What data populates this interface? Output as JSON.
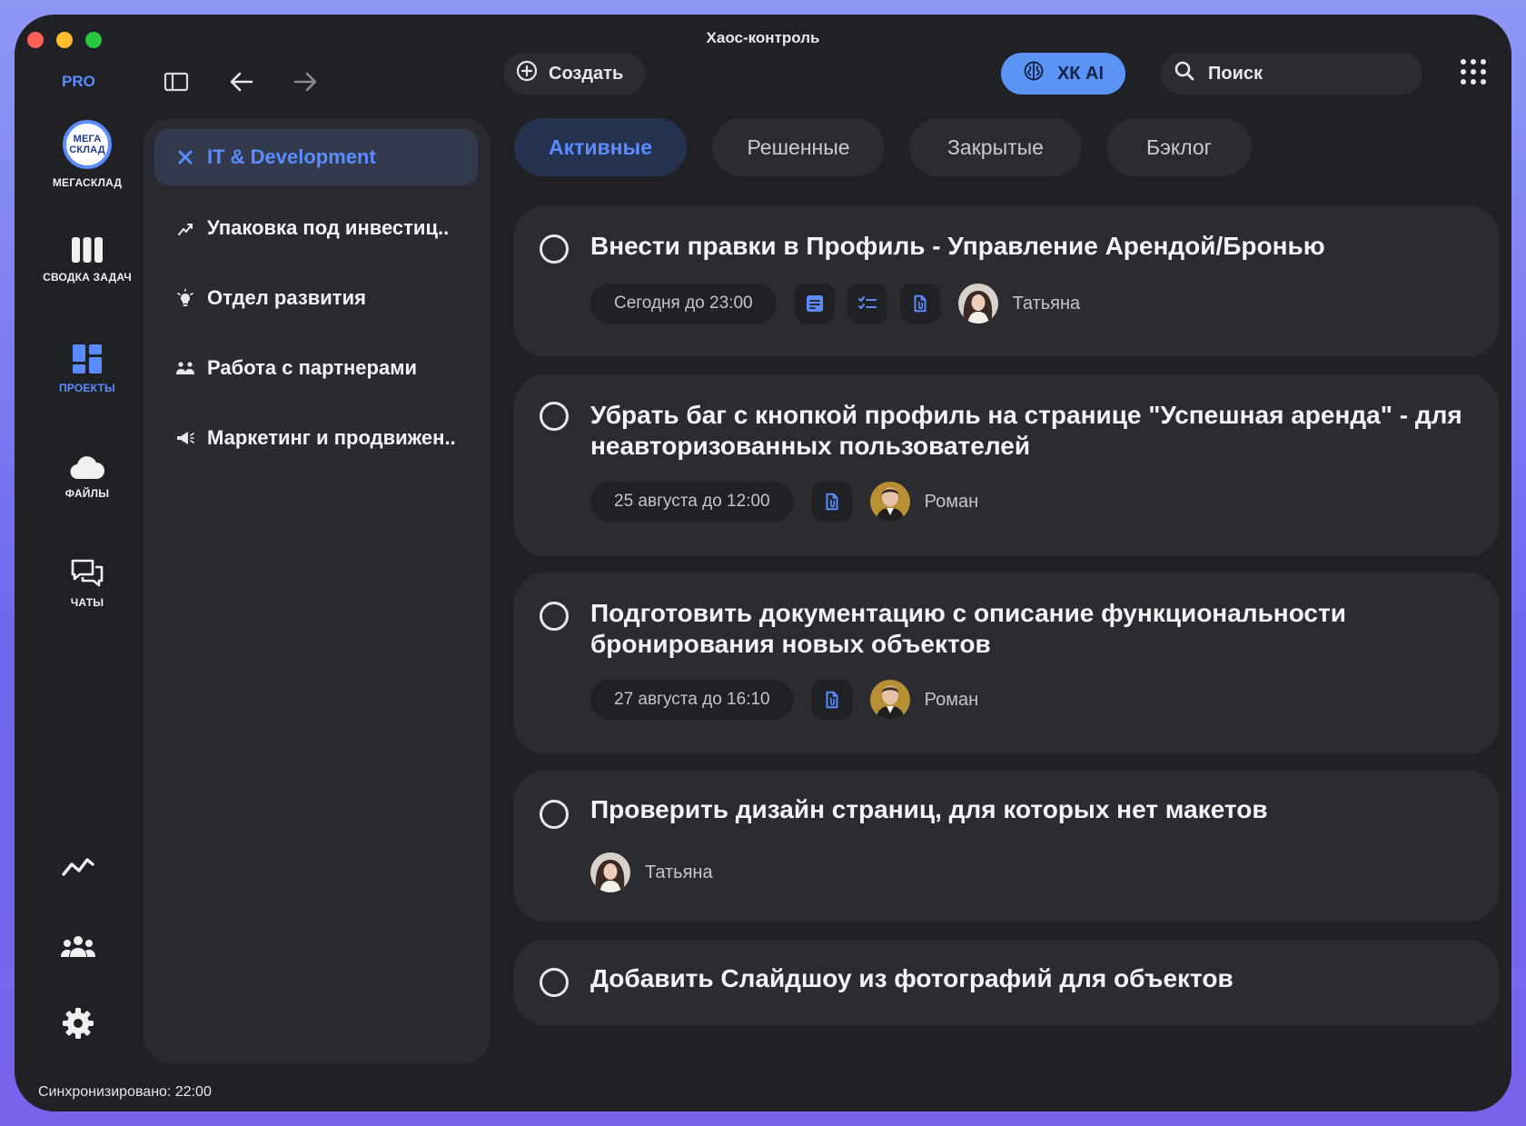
{
  "window": {
    "title": "Хаос-контроль"
  },
  "toolbar": {
    "pro_label": "PRO",
    "create_label": "Создать",
    "ai_label": "ХК AI",
    "search_placeholder": "Поиск"
  },
  "nav": {
    "company_logo_text": "МЕГА СКЛАД",
    "items": [
      {
        "label": "МЕГАСКЛАД",
        "icon": "company-logo"
      },
      {
        "label": "СВОДКА ЗАДАЧ",
        "icon": "columns-icon"
      },
      {
        "label": "ПРОЕКТЫ",
        "icon": "dashboard-icon",
        "active": true
      },
      {
        "label": "ФАЙЛЫ",
        "icon": "cloud-icon"
      },
      {
        "label": "ЧАТЫ",
        "icon": "chat-icon"
      }
    ],
    "bottom_icons": [
      "analytics-icon",
      "team-icon",
      "settings-icon"
    ]
  },
  "projects": [
    {
      "label": "IT & Development",
      "icon": "tools-icon",
      "active": true
    },
    {
      "label": "Упаковка под инвестиц..",
      "icon": "growth-icon"
    },
    {
      "label": "Отдел развития",
      "icon": "lightbulb-icon"
    },
    {
      "label": "Работа с партнерами",
      "icon": "partners-icon"
    },
    {
      "label": "Маркетинг и продвижен..",
      "icon": "megaphone-icon"
    }
  ],
  "tabs": [
    {
      "label": "Активные",
      "active": true
    },
    {
      "label": "Решенные"
    },
    {
      "label": "Закрытые"
    },
    {
      "label": "Бэклог"
    }
  ],
  "tasks": [
    {
      "title": "Внести правки в Профиль - Управление Арендой/Бронью",
      "due": "Сегодня до 23:00",
      "icons": [
        "note-icon",
        "checklist-icon",
        "attachment-icon"
      ],
      "assignee": "Татьяна"
    },
    {
      "title": "Убрать баг с кнопкой профиль на странице \"Успешная аренда\" - для неавторизованных пользователей",
      "due": "25 августа до 12:00",
      "icons": [
        "attachment-icon"
      ],
      "assignee": "Роман"
    },
    {
      "title": "Подготовить документацию с описание функциональности бронирования новых объектов",
      "due": "27 августа до 16:10",
      "icons": [
        "attachment-icon"
      ],
      "assignee": "Роман"
    },
    {
      "title": "Проверить дизайн страниц, для которых нет макетов",
      "assignee": "Татьяна"
    },
    {
      "title": "Добавить Слайдшоу из фотографий для объектов"
    }
  ],
  "status": {
    "sync_text": "Синхронизировано: 22:00"
  },
  "colors": {
    "accent": "#5b8cff",
    "window_bg": "#202125",
    "card_bg": "#2b2c31",
    "frame_gradient_top": "#8f97f5"
  }
}
